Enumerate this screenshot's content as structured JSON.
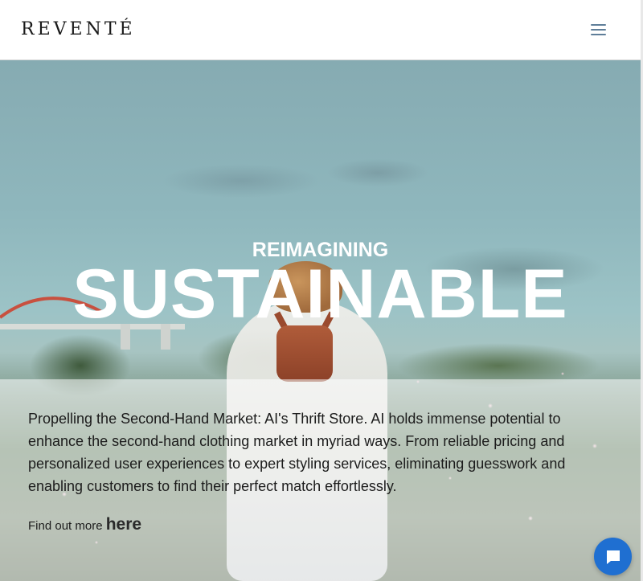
{
  "header": {
    "logo": "REVENTÉ",
    "menu_icon": "hamburger-menu-icon"
  },
  "hero": {
    "eyebrow": "REIMAGINING",
    "headline": "SUSTAINABLE",
    "description": "Propelling the Second-Hand Market: AI's Thrift Store. AI holds immense potential to enhance the second-hand clothing market in myriad ways. From reliable pricing and personalized user experiences to expert styling services, eliminating guesswork and enabling customers to find their perfect match effortlessly.",
    "find_more_prefix": "Find out more",
    "find_more_link": "here"
  },
  "chat": {
    "icon": "chat-bubble-icon",
    "color": "#1f6fd1"
  },
  "colors": {
    "menu_icon": "#5f7e99",
    "headline_text": "#ffffff",
    "body_text": "#1c1c1c"
  }
}
